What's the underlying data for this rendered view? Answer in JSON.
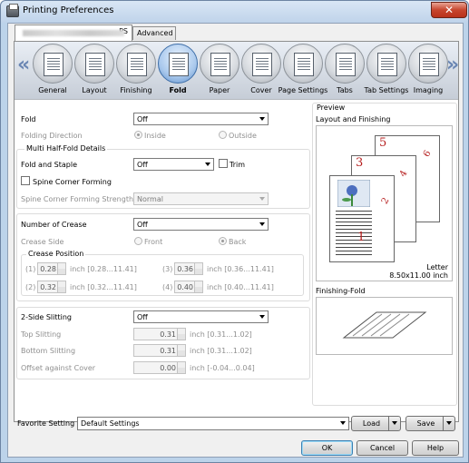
{
  "window": {
    "title": "Printing Preferences",
    "close_glyph": "✕"
  },
  "tabs": [
    {
      "label": "PS",
      "redacted": true
    },
    {
      "label": "Advanced"
    }
  ],
  "functions": [
    {
      "label": "General",
      "icon": "printer-general-icon"
    },
    {
      "label": "Layout",
      "icon": "layout-icon"
    },
    {
      "label": "Finishing",
      "icon": "finishing-icon"
    },
    {
      "label": "Fold",
      "icon": "fold-icon",
      "active": true
    },
    {
      "label": "Paper",
      "icon": "paper-icon"
    },
    {
      "label": "Cover",
      "icon": "cover-icon"
    },
    {
      "label": "Page Settings",
      "icon": "page-settings-icon"
    },
    {
      "label": "Tabs",
      "icon": "tabs-icon"
    },
    {
      "label": "Tab Settings",
      "icon": "tab-settings-icon"
    },
    {
      "label": "Imaging",
      "icon": "imaging-icon"
    }
  ],
  "nav": {
    "prev": "«",
    "next": "»"
  },
  "fold": {
    "fold_label": "Fold",
    "fold_value": "Off",
    "folding_direction_label": "Folding Direction",
    "inside_label": "Inside",
    "outside_label": "Outside",
    "multi_half_fold_label": "Multi Half-Fold Details",
    "fold_and_staple_label": "Fold and Staple",
    "fold_and_staple_value": "Off",
    "trim_label": "Trim",
    "spine_corner_forming_label": "Spine Corner Forming",
    "spine_corner_strength_label": "Spine Corner Forming Strength",
    "spine_corner_strength_value": "Normal"
  },
  "crease": {
    "number_label": "Number of Crease",
    "number_value": "Off",
    "side_label": "Crease Side",
    "front_label": "Front",
    "back_label": "Back",
    "position_label": "Crease Position",
    "positions": [
      {
        "index": "(1)",
        "value": "0.28",
        "range": "inch [0.28...11.41]"
      },
      {
        "index": "(2)",
        "value": "0.32",
        "range": "inch [0.32...11.41]"
      },
      {
        "index": "(3)",
        "value": "0.36",
        "range": "inch [0.36...11.41]"
      },
      {
        "index": "(4)",
        "value": "0.40",
        "range": "inch [0.40...11.41]"
      }
    ]
  },
  "slitting": {
    "label": "2-Side Slitting",
    "value": "Off",
    "top_label": "Top Slitting",
    "top_value": "0.31",
    "top_range": "inch [0.31...1.02]",
    "bottom_label": "Bottom Slitting",
    "bottom_value": "0.31",
    "bottom_range": "inch [0.31...1.02]",
    "offset_label": "Offset against Cover",
    "offset_value": "0.00",
    "offset_range": "inch [-0.04...0.04]"
  },
  "preview": {
    "title": "Preview",
    "layout_label": "Layout and Finishing",
    "sheet_numbers": [
      "1",
      "2",
      "3",
      "4",
      "5",
      "6"
    ],
    "paper_name": "Letter",
    "paper_size": "8.50x11.00 inch",
    "finishing_fold_label": "Finishing-Fold"
  },
  "footer": {
    "favorite_label": "Favorite Setting",
    "favorite_value": "Default Settings",
    "load_label": "Load",
    "save_label": "Save",
    "ok_label": "OK",
    "cancel_label": "Cancel",
    "help_label": "Help"
  },
  "colors": {
    "accent": "#3e6ea8",
    "sheet_number": "#b51d1d"
  }
}
